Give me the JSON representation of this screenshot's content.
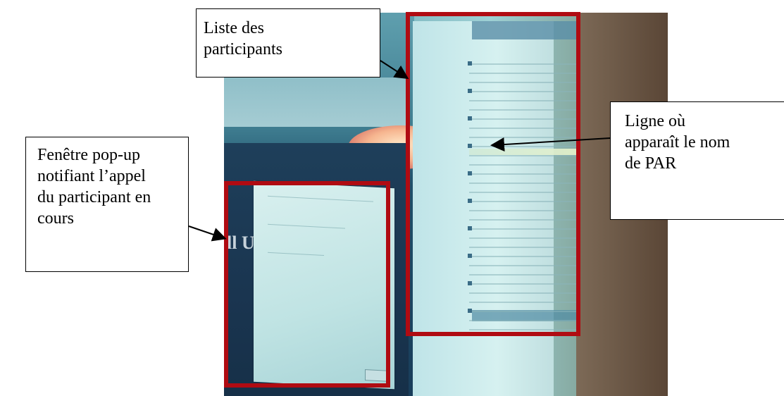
{
  "callouts": {
    "liste": [
      "Liste des",
      "participants"
    ],
    "ligne": [
      "Ligne où",
      "apparaît le nom",
      "de PAR"
    ],
    "popup": [
      "Fenêtre pop-up",
      "notifiant l’appel",
      "du participant en",
      "cours"
    ]
  },
  "photo": {
    "desktop_text": "ll Uni"
  },
  "colors": {
    "highlight_border": "#b00b12",
    "callout_border": "#000000"
  }
}
